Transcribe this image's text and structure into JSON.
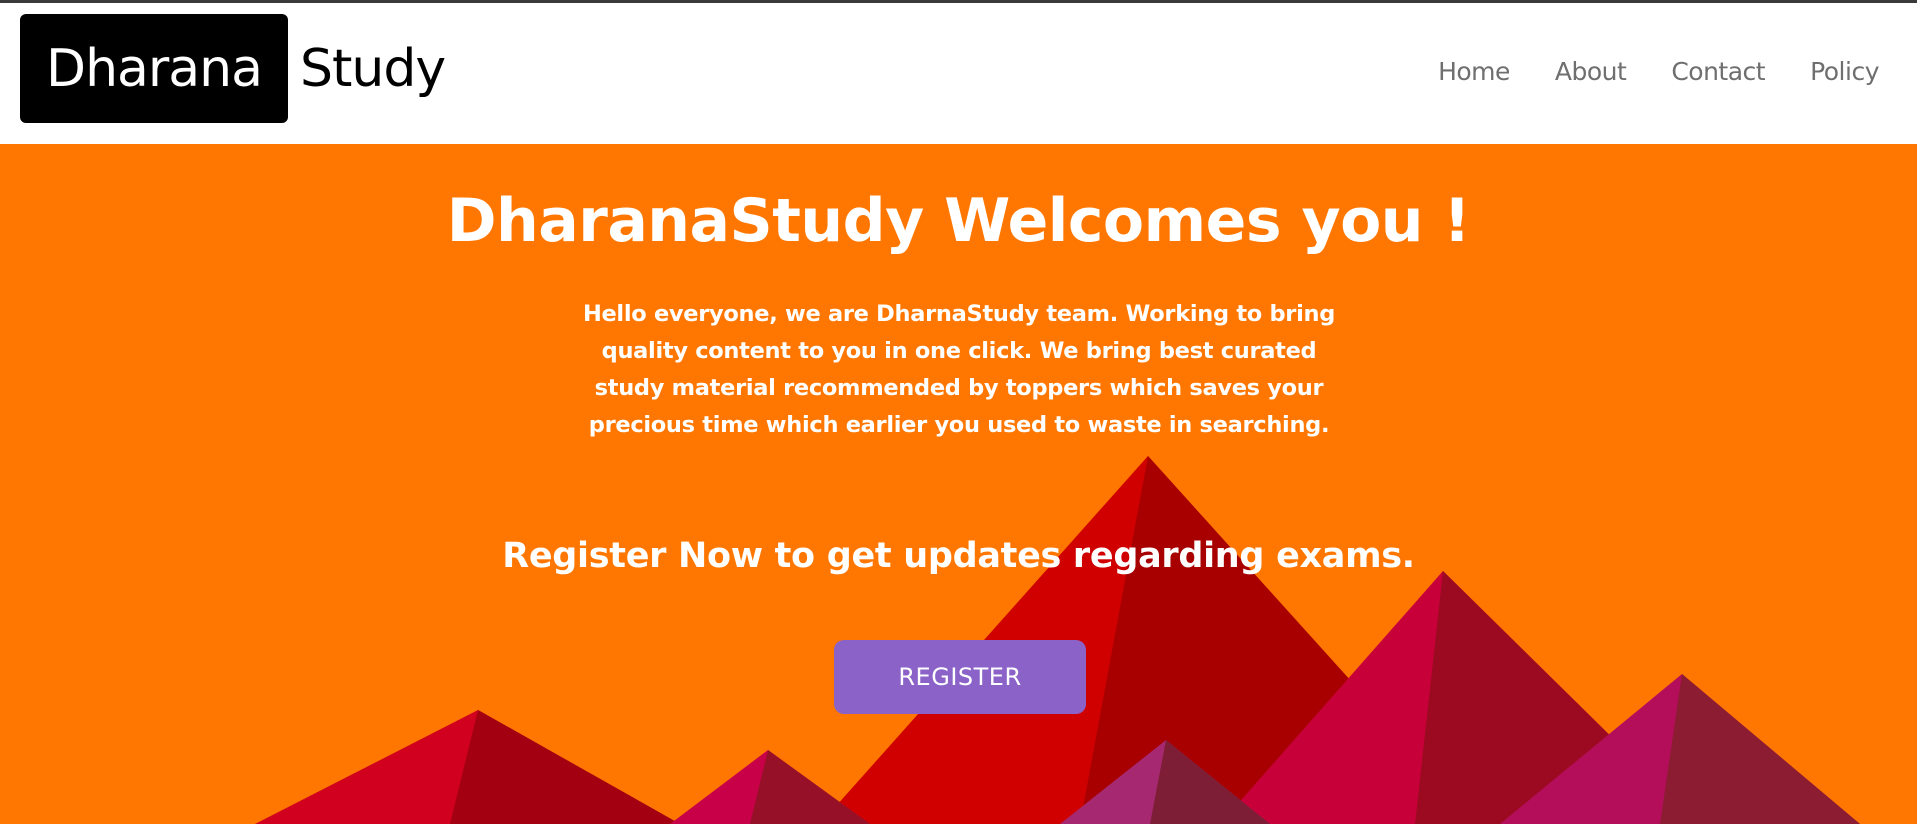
{
  "navbar": {
    "logo_part1": "Dharana",
    "logo_part2": "Study",
    "links": [
      {
        "label": "Home"
      },
      {
        "label": "About"
      },
      {
        "label": "Contact"
      },
      {
        "label": "Policy"
      }
    ]
  },
  "hero": {
    "title": "DharanaStudy Welcomes you !",
    "description": "Hello everyone, we are DharnaStudy team. Working to bring quality content to you in one click. We bring best curated study material recommended by toppers which saves your precious time which earlier you used to waste in searching.",
    "subtitle": "Register Now to get updates regarding exams.",
    "register_label": "REGISTER"
  },
  "colors": {
    "hero_background": "#ff7700",
    "register_button": "#8a62c8",
    "logo_box": "#000000",
    "nav_link": "#6f6f6f"
  }
}
